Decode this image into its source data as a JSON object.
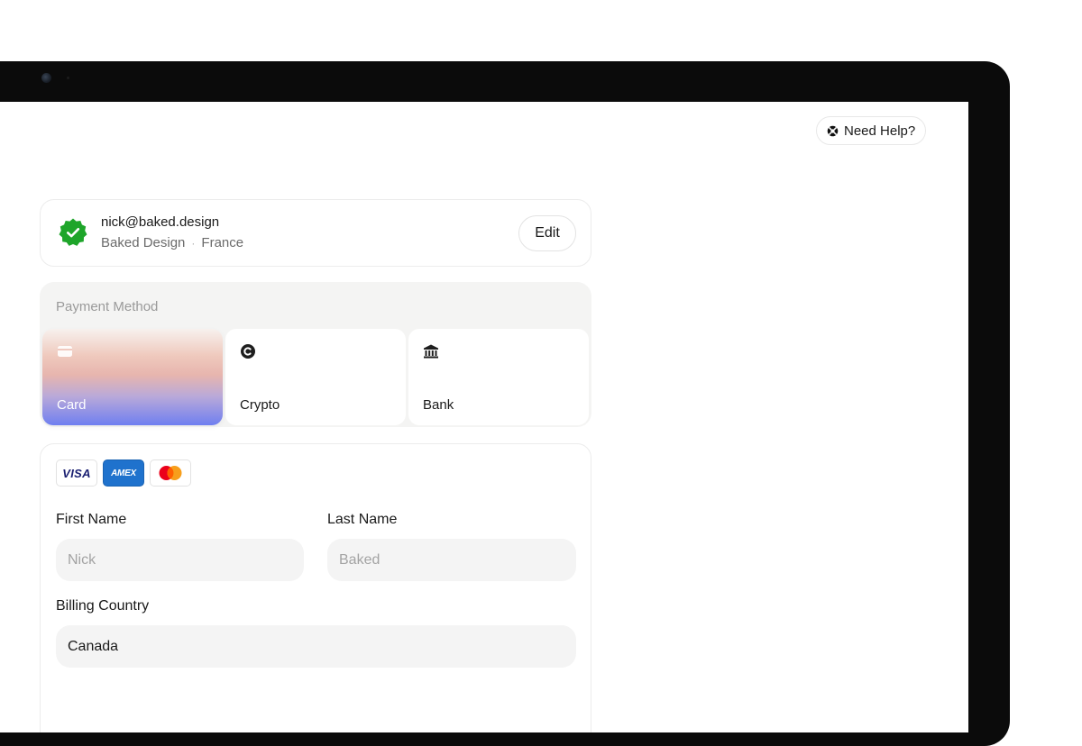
{
  "header": {
    "help_label": "Need Help?"
  },
  "account": {
    "email": "nick@baked.design",
    "company": "Baked Design",
    "separator": "·",
    "country": "France",
    "edit_label": "Edit"
  },
  "payment_method": {
    "title": "Payment Method",
    "selected": "Card",
    "options": [
      {
        "label": "Card",
        "icon": "credit-card-icon"
      },
      {
        "label": "Crypto",
        "icon": "crypto-coin-icon"
      },
      {
        "label": "Bank",
        "icon": "bank-icon"
      }
    ]
  },
  "form": {
    "brands": [
      {
        "name": "VISA",
        "color": "#1a1f71"
      },
      {
        "name": "AMEX",
        "color": "#1f72cd"
      },
      {
        "name": "mastercard-logo",
        "colors": [
          "#eb001b",
          "#f79e1b"
        ]
      }
    ],
    "first_name": {
      "label": "First Name",
      "placeholder": "Nick"
    },
    "last_name": {
      "label": "Last Name",
      "placeholder": "Baked"
    },
    "billing_country": {
      "label": "Billing Country",
      "value": "Canada"
    }
  },
  "colors": {
    "verified": "#1ea52a",
    "card_gradient": [
      "#f7f1ee",
      "#efc9bd",
      "#b9a9d9",
      "#6f7ff0"
    ]
  }
}
